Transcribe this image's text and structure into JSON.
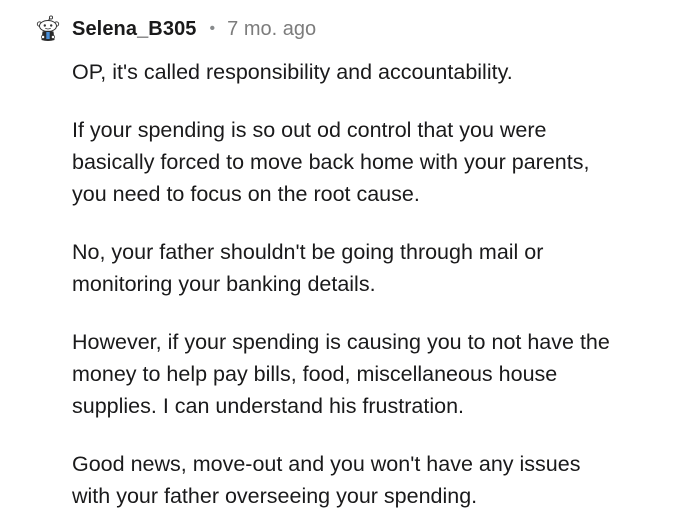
{
  "comment": {
    "author": "Selena_B305",
    "separator": "•",
    "age": "7 mo. ago",
    "avatar_icon": "reddit-snoo-avatar-icon",
    "paragraphs": [
      "OP, it's called responsibility and accountability.",
      "If your spending is so out od control that you were\nbasically forced to move back home with your parents,\nyou need to focus on the root cause.",
      "No, your father shouldn't be going through mail or\nmonitoring your banking details.",
      "However, if your spending is causing you to not have the\nmoney to help pay bills, food, miscellaneous house\nsupplies. I can understand his frustration.",
      "Good news, move-out and you won't have any issues\nwith your father overseeing your spending."
    ]
  }
}
